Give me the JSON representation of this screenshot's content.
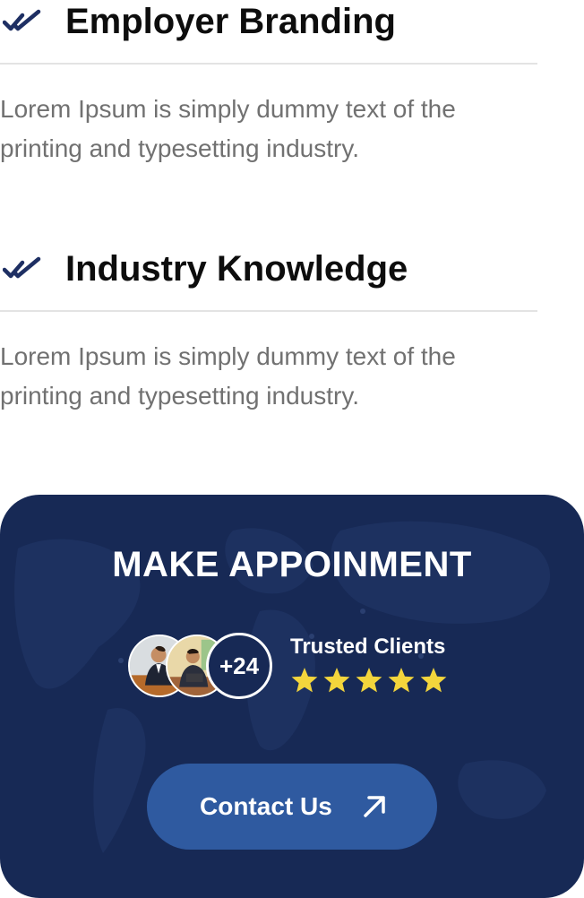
{
  "features": [
    {
      "title": "Employer Branding",
      "text": "Lorem Ipsum is simply dummy text of the printing and typesetting industry.",
      "icon": "double-check-icon"
    },
    {
      "title": "Industry Knowledge",
      "text": "Lorem Ipsum is simply dummy text of the printing and typesetting industry.",
      "icon": "double-check-icon"
    }
  ],
  "appointment": {
    "title": "MAKE APPOINMENT",
    "client_count": "+24",
    "trusted_label": "Trusted Clients",
    "rating": 5,
    "button_label": "Contact Us",
    "button_icon": "arrow-up-right-icon"
  },
  "colors": {
    "navy": "#172955",
    "button_blue": "#2f5aa0",
    "star_yellow": "#f3d53c",
    "check_navy": "#1e2f63"
  }
}
